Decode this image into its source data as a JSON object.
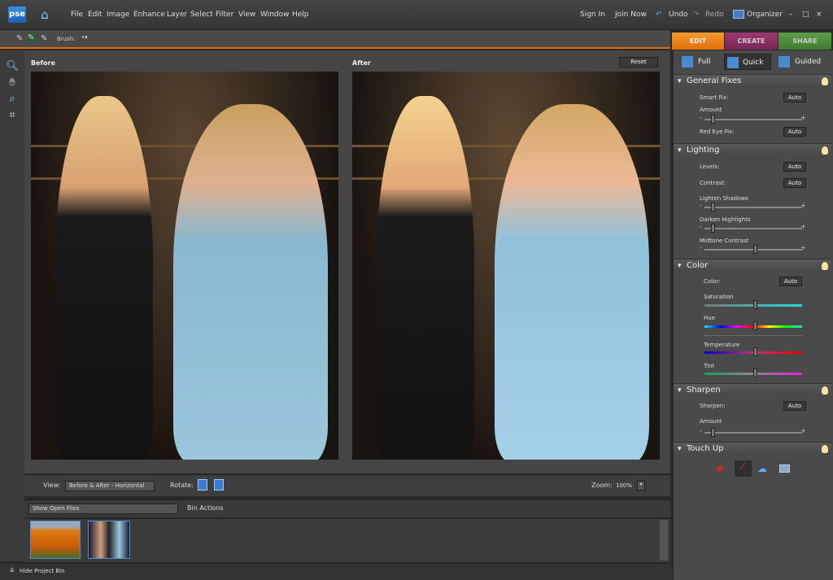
{
  "app": {
    "logo": "pse"
  },
  "menu": [
    "File",
    "Edit",
    "Image",
    "Enhance",
    "Layer",
    "Select",
    "Filter",
    "View",
    "Window",
    "Help"
  ],
  "right_menu": {
    "sign_in": "Sign In",
    "join_now": "Join Now",
    "undo": "Undo",
    "redo": "Redo",
    "organizer": "Organizer"
  },
  "toolbar": {
    "brush_label": "Brush:"
  },
  "tabs": [
    {
      "label": "EDIT",
      "color": "#e8790f"
    },
    {
      "label": "CREATE",
      "color": "#8c2d63"
    },
    {
      "label": "SHARE",
      "color": "#4b8b3a"
    }
  ],
  "modes": [
    "Full",
    "Quick",
    "Guided"
  ],
  "active_mode": "Quick",
  "canvas": {
    "before": "Before",
    "after": "After",
    "reset": "Reset"
  },
  "viewbar": {
    "view_label": "View:",
    "view_value": "Before & After - Horizontal",
    "rotate_label": "Rotate:",
    "zoom_label": "Zoom:",
    "zoom_value": "100%"
  },
  "bin": {
    "show": "Show Open Files",
    "actions": "Bin Actions",
    "hide": "Hide Project Bin"
  },
  "panel": {
    "general": {
      "title": "General Fixes",
      "smart_fix": "Smart Fix:",
      "amount": "Amount",
      "red_eye": "Red Eye Fix:",
      "auto": "Auto",
      "amount_value": 0
    },
    "lighting": {
      "title": "Lighting",
      "levels": "Levels:",
      "contrast": "Contrast:",
      "lighten": "Lighten Shadows",
      "darken": "Darken Highlights",
      "midtone": "Midtone Contrast",
      "auto": "Auto",
      "lighten_value": 0,
      "darken_value": 0,
      "midtone_value": 0.5
    },
    "color": {
      "title": "Color",
      "color": "Color:",
      "auto": "Auto",
      "saturation": "Saturation",
      "hue": "Hue",
      "temperature": "Temperature",
      "tint": "Tint",
      "saturation_value": 0.5,
      "hue_value": 0.5,
      "temperature_value": 0.5,
      "tint_value": 0.5
    },
    "sharpen": {
      "title": "Sharpen",
      "sharpen": "Sharpen:",
      "auto": "Auto",
      "amount": "Amount",
      "amount_value": 0
    },
    "touchup": {
      "title": "Touch Up",
      "icons": [
        "red-eye-icon",
        "whiten-teeth-icon",
        "blue-sky-icon",
        "black-and-white-icon"
      ]
    }
  }
}
